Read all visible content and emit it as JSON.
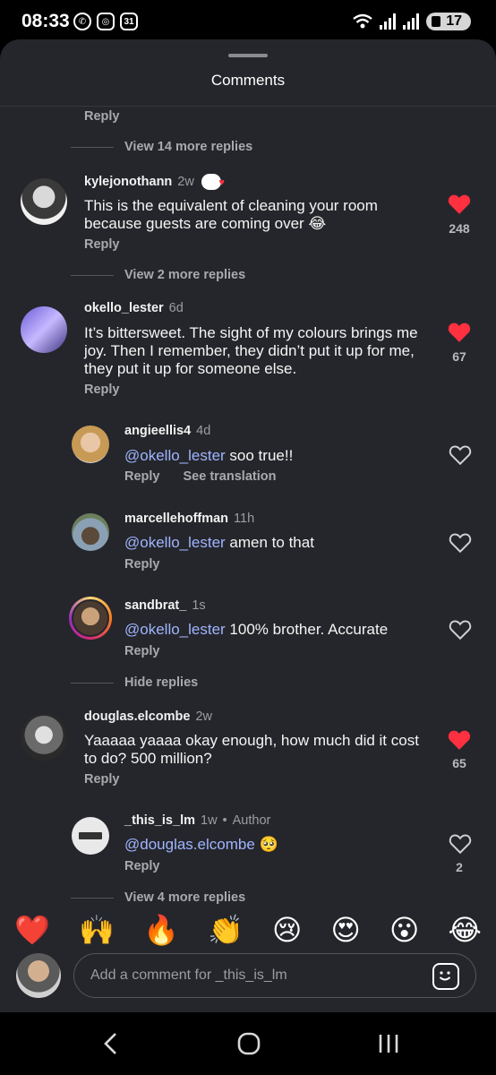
{
  "status": {
    "time": "08:33",
    "calendar_day": "31",
    "battery": "17"
  },
  "sheet": {
    "title": "Comments"
  },
  "thread0": {
    "reply_label": "Reply",
    "view_more": "View 14 more replies"
  },
  "comments": [
    {
      "username": "kylejonothann",
      "age": "2w",
      "text": "This is the equivalent of cleaning your room because guests are coming over 😂",
      "reply": "Reply",
      "likes": "248",
      "liked": true,
      "view_more": "View 2 more replies"
    },
    {
      "username": "okello_lester",
      "age": "6d",
      "text": "It’s bittersweet. The sight of my colours brings me joy. Then I remember, they didn’t put it up for me, they put it up for someone else.",
      "reply": "Reply",
      "likes": "67",
      "liked": true,
      "replies": [
        {
          "username": "angieellis4",
          "age": "4d",
          "mention": "@okello_lester",
          "text": " soo true!!",
          "reply": "Reply",
          "translate": "See translation",
          "liked": false
        },
        {
          "username": "marcellehoffman",
          "age": "11h",
          "mention": "@okello_lester",
          "text": " amen to that",
          "reply": "Reply",
          "liked": false
        },
        {
          "username": "sandbrat_",
          "age": "1s",
          "mention": "@okello_lester",
          "text": " 100% brother. Accurate",
          "reply": "Reply",
          "liked": false
        }
      ],
      "hide_replies": "Hide replies"
    },
    {
      "username": "douglas.elcombe",
      "age": "2w",
      "text": "Yaaaaa yaaaa okay enough, how much did it cost to do?  500 million?",
      "reply": "Reply",
      "likes": "65",
      "liked": true,
      "replies": [
        {
          "username": "_this_is_lm",
          "age": "1w",
          "author_badge": "Author",
          "mention": "@douglas.elcombe",
          "text": " 🥺",
          "reply": "Reply",
          "likes": "2",
          "liked": false
        }
      ],
      "view_more": "View 4 more replies"
    }
  ],
  "reactions": [
    "❤️",
    "🙌",
    "🔥",
    "👏",
    "😢",
    "😍",
    "😮",
    "😂"
  ],
  "composer": {
    "placeholder": "Add a comment for _this_is_lm"
  },
  "colors": {
    "background": "#25262b",
    "like_red": "#ff3040",
    "mention": "#9fb4ff"
  },
  "icons": [
    "back-icon",
    "home-icon",
    "recents-icon",
    "sticker-icon",
    "heart-icon"
  ]
}
